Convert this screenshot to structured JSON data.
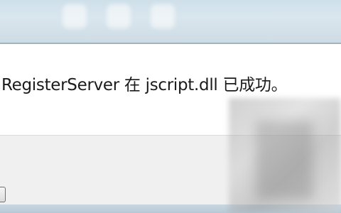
{
  "dialog": {
    "message": "RegisterServer 在 jscript.dll 已成功。"
  },
  "colors": {
    "titlebar": "#d9e6ee",
    "message_bg": "#ffffff",
    "footer_bg": "#f0f0f0",
    "text": "#1b1b1b"
  }
}
